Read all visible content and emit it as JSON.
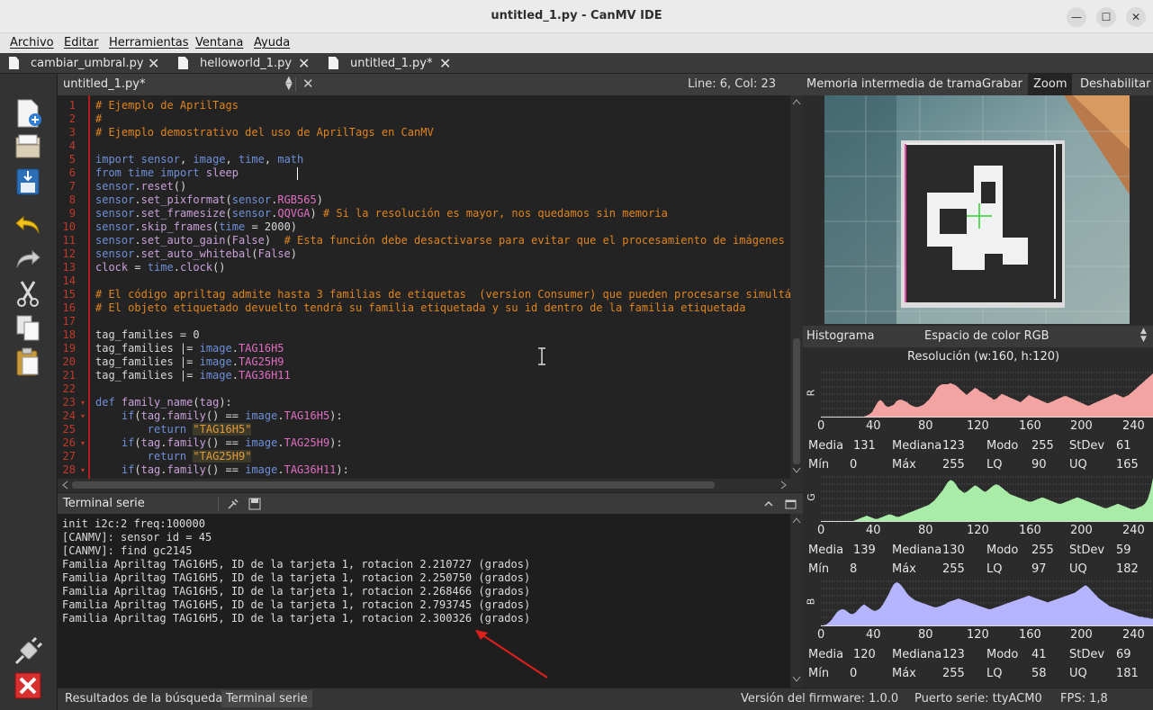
{
  "window": {
    "title": "untitled_1.py - CanMV IDE",
    "minimize_glyph": "—",
    "maximize_glyph": "☐",
    "close_glyph": "✕"
  },
  "menu": [
    "Archivo",
    "Editar",
    "Herramientas",
    "Ventana",
    "Ayuda"
  ],
  "file_tabs": [
    {
      "label": "cambiar_umbral.py",
      "close": "✕"
    },
    {
      "label": "helloworld_1.py",
      "close": "✕"
    },
    {
      "label": "untitled_1.py*",
      "close": "✕"
    }
  ],
  "toolbar_icons": [
    "new-file-icon",
    "open-file-icon",
    "save-file-icon",
    "undo-icon",
    "redo-icon",
    "cut-icon",
    "copy-icon",
    "paste-icon",
    "connect-icon",
    "stop-icon"
  ],
  "editor": {
    "file_name": "untitled_1.py*",
    "cursor_position": "Line: 6, Col: 23",
    "close_glyph": "✕",
    "line_numbers": [
      "1",
      "2",
      "3",
      "4",
      "5",
      "6",
      "7",
      "8",
      "9",
      "10",
      "11",
      "12",
      "13",
      "14",
      "15",
      "16",
      "17",
      "18",
      "19",
      "20",
      "21",
      "22",
      "23",
      "24",
      "25",
      "26",
      "27",
      "28"
    ],
    "lines": [
      "# Ejemplo de AprilTags",
      "#",
      "# Ejemplo demostrativo del uso de AprilTags en CanMV",
      "",
      "import sensor, image, time, math",
      "from time import sleep",
      "sensor.reset()",
      "sensor.set_pixformat(sensor.RGB565)",
      "sensor.set_framesize(sensor.QQVGA) # Si la resolución es mayor, nos quedamos sin memoria",
      "sensor.skip_frames(time = 2000)",
      "sensor.set_auto_gain(False)  # Esta función debe desactivarse para evitar que el procesamiento de imágenes",
      "sensor.set_auto_whitebal(False)",
      "clock = time.clock()",
      "",
      "# El código apriltag admite hasta 3 familias de etiquetas  (version Consumer) que pueden procesarse simultá",
      "# El objeto etiquetado devuelto tendrá su familia etiquetada y su id dentro de la familia etiquetada",
      "",
      "tag_families = 0",
      "tag_families |= image.TAG16H5",
      "tag_families |= image.TAG25H9",
      "tag_families |= image.TAG36H11",
      "",
      "def family_name(tag):",
      "    if(tag.family() == image.TAG16H5):",
      "        return \"TAG16H5\"",
      "    if(tag.family() == image.TAG25H9):",
      "        return \"TAG25H9\"",
      "    if(tag.family() == image.TAG36H11):"
    ]
  },
  "terminal": {
    "title": "Terminal serie",
    "lines": [
      "init i2c:2 freq:100000",
      "[CANMV]: sensor id = 45",
      "[CANMV]: find gc2145",
      "Familia Apriltag TAG16H5, ID de la tarjeta 1, rotacion 2.210727 (grados)",
      "Familia Apriltag TAG16H5, ID de la tarjeta 1, rotacion 2.250750 (grados)",
      "Familia Apriltag TAG16H5, ID de la tarjeta 1, rotacion 2.268466 (grados)",
      "Familia Apriltag TAG16H5, ID de la tarjeta 1, rotacion 2.793745 (grados)",
      "Familia Apriltag TAG16H5, ID de la tarjeta 1, rotacion 2.300326 (grados)"
    ]
  },
  "statusbar": {
    "tab_search": "Resultados de la búsqueda",
    "tab_terminal": "Terminal serie",
    "firmware": "Versión del firmware: 1.0.0",
    "port": "Puerto serie: ttyACM0",
    "fps": "FPS:  1,8"
  },
  "framebuffer": {
    "title": "Memoria intermedia de trama",
    "record": "Grabar",
    "zoom": "Zoom",
    "disable": "Deshabilitar"
  },
  "histogram": {
    "title": "Histograma",
    "colorspace": "Espacio de color RGB",
    "resolution": "Resolución (w:160, h:120)",
    "x_ticks": [
      "0",
      "40",
      "80",
      "120",
      "160",
      "200",
      "240"
    ],
    "channels": [
      {
        "label": "R",
        "color": "#f4a3a3",
        "stats": {
          "Media": "131",
          "Mediana": "123",
          "Modo": "255",
          "StDev": "61",
          "Mín": "0",
          "Máx": "255",
          "LQ": "90",
          "UQ": "165"
        },
        "values": [
          0,
          0,
          0,
          0,
          0,
          0,
          0,
          0,
          0,
          0,
          0,
          0,
          0,
          0,
          0,
          0,
          0,
          1,
          2,
          4,
          8,
          12,
          14,
          12,
          9,
          8,
          9,
          10,
          13,
          14,
          14,
          13,
          12,
          10,
          9,
          8,
          8,
          9,
          10,
          12,
          14,
          17,
          20,
          24,
          26,
          27,
          27,
          27,
          28,
          27,
          26,
          24,
          22,
          20,
          18,
          20,
          22,
          24,
          23,
          21,
          20,
          19,
          17,
          16,
          14,
          15,
          17,
          19,
          18,
          17,
          16,
          15,
          14,
          13,
          12,
          14,
          16,
          18,
          17,
          16,
          15,
          14,
          13,
          12,
          11,
          12,
          13,
          14,
          15,
          16,
          17,
          17,
          16,
          15,
          14,
          13,
          12,
          11,
          10,
          9,
          10,
          11,
          12,
          13,
          14,
          15,
          16,
          17,
          18,
          19,
          18,
          17,
          16,
          17,
          18,
          20,
          22,
          24,
          26,
          28,
          30,
          32,
          34,
          36
        ]
      },
      {
        "label": "G",
        "color": "#a8eca8",
        "stats": {
          "Media": "139",
          "Mediana": "130",
          "Modo": "255",
          "StDev": "59",
          "Mín": "8",
          "Máx": "255",
          "LQ": "97",
          "UQ": "182"
        },
        "values": [
          0,
          0,
          0,
          0,
          0,
          0,
          0,
          0,
          0,
          0,
          0,
          0,
          0,
          1,
          2,
          3,
          4,
          5,
          4,
          3,
          2,
          2,
          3,
          4,
          5,
          6,
          6,
          5,
          4,
          4,
          5,
          6,
          7,
          8,
          9,
          10,
          11,
          12,
          13,
          14,
          15,
          17,
          19,
          22,
          25,
          28,
          32,
          36,
          38,
          37,
          34,
          30,
          28,
          26,
          27,
          29,
          31,
          33,
          32,
          30,
          28,
          27,
          29,
          31,
          33,
          34,
          33,
          31,
          29,
          27,
          25,
          24,
          23,
          22,
          21,
          20,
          19,
          18,
          18,
          19,
          20,
          21,
          22,
          21,
          20,
          19,
          18,
          17,
          16,
          16,
          17,
          18,
          19,
          20,
          21,
          22,
          21,
          20,
          19,
          18,
          17,
          16,
          15,
          14,
          13,
          12,
          12,
          13,
          14,
          15,
          16,
          15,
          14,
          13,
          12,
          11,
          11,
          12,
          13,
          14,
          16,
          20,
          28,
          40
        ]
      },
      {
        "label": "B",
        "color": "#b4b4ff",
        "stats": {
          "Media": "120",
          "Mediana": "123",
          "Modo": "41",
          "StDev": "69",
          "Mín": "0",
          "Máx": "255",
          "LQ": "58",
          "UQ": "181"
        },
        "values": [
          0,
          0,
          1,
          3,
          6,
          10,
          14,
          16,
          17,
          16,
          14,
          12,
          12,
          14,
          17,
          20,
          22,
          20,
          18,
          16,
          15,
          16,
          18,
          22,
          27,
          32,
          38,
          43,
          45,
          44,
          41,
          37,
          33,
          30,
          28,
          26,
          25,
          24,
          23,
          22,
          21,
          20,
          19,
          19,
          20,
          21,
          22,
          24,
          25,
          26,
          27,
          28,
          27,
          26,
          25,
          24,
          23,
          22,
          21,
          20,
          19,
          18,
          17,
          17,
          18,
          19,
          20,
          21,
          22,
          23,
          24,
          25,
          26,
          27,
          28,
          29,
          30,
          31,
          30,
          29,
          28,
          27,
          26,
          25,
          24,
          25,
          26,
          27,
          28,
          29,
          30,
          31,
          32,
          33,
          34,
          36,
          38,
          40,
          42,
          40,
          37,
          34,
          31,
          28,
          26,
          24,
          22,
          20,
          19,
          18,
          17,
          16,
          15,
          14,
          13,
          12,
          11,
          10,
          9,
          9,
          8,
          8,
          7,
          7
        ]
      }
    ]
  }
}
